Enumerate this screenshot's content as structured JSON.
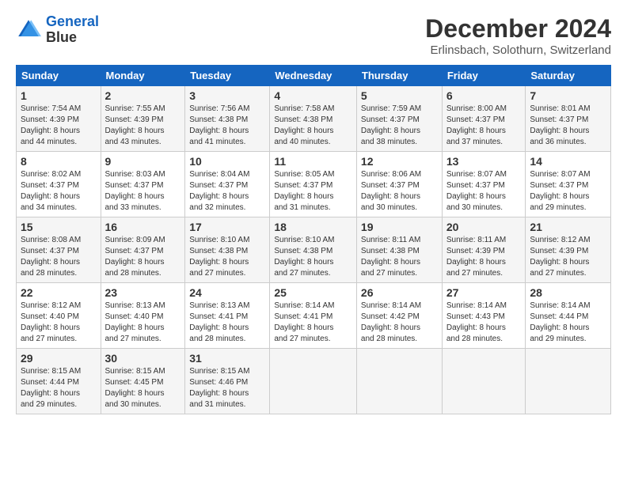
{
  "logo": {
    "line1": "General",
    "line2": "Blue"
  },
  "title": "December 2024",
  "subtitle": "Erlinsbach, Solothurn, Switzerland",
  "days_of_week": [
    "Sunday",
    "Monday",
    "Tuesday",
    "Wednesday",
    "Thursday",
    "Friday",
    "Saturday"
  ],
  "weeks": [
    [
      {
        "day": "1",
        "info": "Sunrise: 7:54 AM\nSunset: 4:39 PM\nDaylight: 8 hours\nand 44 minutes."
      },
      {
        "day": "2",
        "info": "Sunrise: 7:55 AM\nSunset: 4:39 PM\nDaylight: 8 hours\nand 43 minutes."
      },
      {
        "day": "3",
        "info": "Sunrise: 7:56 AM\nSunset: 4:38 PM\nDaylight: 8 hours\nand 41 minutes."
      },
      {
        "day": "4",
        "info": "Sunrise: 7:58 AM\nSunset: 4:38 PM\nDaylight: 8 hours\nand 40 minutes."
      },
      {
        "day": "5",
        "info": "Sunrise: 7:59 AM\nSunset: 4:37 PM\nDaylight: 8 hours\nand 38 minutes."
      },
      {
        "day": "6",
        "info": "Sunrise: 8:00 AM\nSunset: 4:37 PM\nDaylight: 8 hours\nand 37 minutes."
      },
      {
        "day": "7",
        "info": "Sunrise: 8:01 AM\nSunset: 4:37 PM\nDaylight: 8 hours\nand 36 minutes."
      }
    ],
    [
      {
        "day": "8",
        "info": "Sunrise: 8:02 AM\nSunset: 4:37 PM\nDaylight: 8 hours\nand 34 minutes."
      },
      {
        "day": "9",
        "info": "Sunrise: 8:03 AM\nSunset: 4:37 PM\nDaylight: 8 hours\nand 33 minutes."
      },
      {
        "day": "10",
        "info": "Sunrise: 8:04 AM\nSunset: 4:37 PM\nDaylight: 8 hours\nand 32 minutes."
      },
      {
        "day": "11",
        "info": "Sunrise: 8:05 AM\nSunset: 4:37 PM\nDaylight: 8 hours\nand 31 minutes."
      },
      {
        "day": "12",
        "info": "Sunrise: 8:06 AM\nSunset: 4:37 PM\nDaylight: 8 hours\nand 30 minutes."
      },
      {
        "day": "13",
        "info": "Sunrise: 8:07 AM\nSunset: 4:37 PM\nDaylight: 8 hours\nand 30 minutes."
      },
      {
        "day": "14",
        "info": "Sunrise: 8:07 AM\nSunset: 4:37 PM\nDaylight: 8 hours\nand 29 minutes."
      }
    ],
    [
      {
        "day": "15",
        "info": "Sunrise: 8:08 AM\nSunset: 4:37 PM\nDaylight: 8 hours\nand 28 minutes."
      },
      {
        "day": "16",
        "info": "Sunrise: 8:09 AM\nSunset: 4:37 PM\nDaylight: 8 hours\nand 28 minutes."
      },
      {
        "day": "17",
        "info": "Sunrise: 8:10 AM\nSunset: 4:38 PM\nDaylight: 8 hours\nand 27 minutes."
      },
      {
        "day": "18",
        "info": "Sunrise: 8:10 AM\nSunset: 4:38 PM\nDaylight: 8 hours\nand 27 minutes."
      },
      {
        "day": "19",
        "info": "Sunrise: 8:11 AM\nSunset: 4:38 PM\nDaylight: 8 hours\nand 27 minutes."
      },
      {
        "day": "20",
        "info": "Sunrise: 8:11 AM\nSunset: 4:39 PM\nDaylight: 8 hours\nand 27 minutes."
      },
      {
        "day": "21",
        "info": "Sunrise: 8:12 AM\nSunset: 4:39 PM\nDaylight: 8 hours\nand 27 minutes."
      }
    ],
    [
      {
        "day": "22",
        "info": "Sunrise: 8:12 AM\nSunset: 4:40 PM\nDaylight: 8 hours\nand 27 minutes."
      },
      {
        "day": "23",
        "info": "Sunrise: 8:13 AM\nSunset: 4:40 PM\nDaylight: 8 hours\nand 27 minutes."
      },
      {
        "day": "24",
        "info": "Sunrise: 8:13 AM\nSunset: 4:41 PM\nDaylight: 8 hours\nand 28 minutes."
      },
      {
        "day": "25",
        "info": "Sunrise: 8:14 AM\nSunset: 4:41 PM\nDaylight: 8 hours\nand 27 minutes."
      },
      {
        "day": "26",
        "info": "Sunrise: 8:14 AM\nSunset: 4:42 PM\nDaylight: 8 hours\nand 28 minutes."
      },
      {
        "day": "27",
        "info": "Sunrise: 8:14 AM\nSunset: 4:43 PM\nDaylight: 8 hours\nand 28 minutes."
      },
      {
        "day": "28",
        "info": "Sunrise: 8:14 AM\nSunset: 4:44 PM\nDaylight: 8 hours\nand 29 minutes."
      }
    ],
    [
      {
        "day": "29",
        "info": "Sunrise: 8:15 AM\nSunset: 4:44 PM\nDaylight: 8 hours\nand 29 minutes."
      },
      {
        "day": "30",
        "info": "Sunrise: 8:15 AM\nSunset: 4:45 PM\nDaylight: 8 hours\nand 30 minutes."
      },
      {
        "day": "31",
        "info": "Sunrise: 8:15 AM\nSunset: 4:46 PM\nDaylight: 8 hours\nand 31 minutes."
      },
      null,
      null,
      null,
      null
    ]
  ]
}
